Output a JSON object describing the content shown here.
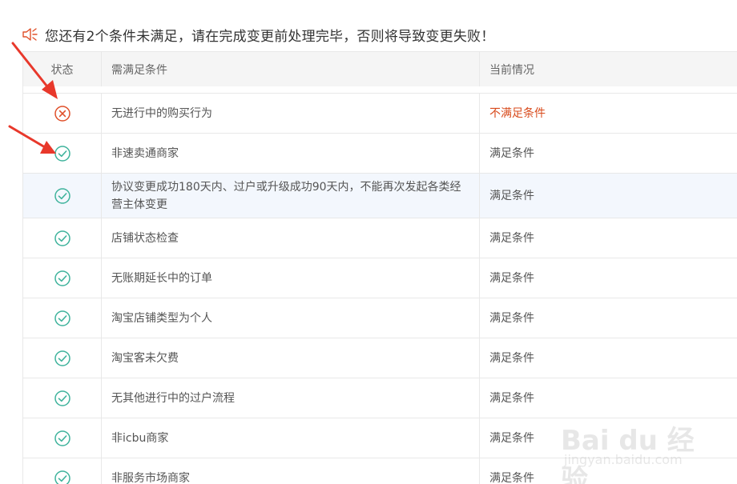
{
  "notice": {
    "icon": "speaker-icon",
    "message": "您还有2个条件未满足，请在完成变更前处理完毕，否则将导致变更失败！"
  },
  "table": {
    "headers": {
      "status": "状态",
      "condition": "需满足条件",
      "current": "当前情况"
    },
    "rows": [
      {
        "status": "fail",
        "condition": "无进行中的购买行为",
        "current": "不满足条件"
      },
      {
        "status": "ok",
        "condition": "非速卖通商家",
        "current": "满足条件"
      },
      {
        "status": "ok",
        "condition": "协议变更成功180天内、过户或升级成功90天内，不能再次发起各类经营主体变更",
        "current": "满足条件"
      },
      {
        "status": "ok",
        "condition": "店铺状态检查",
        "current": "满足条件"
      },
      {
        "status": "ok",
        "condition": "无账期延长中的订单",
        "current": "满足条件"
      },
      {
        "status": "ok",
        "condition": "淘宝店铺类型为个人",
        "current": "满足条件"
      },
      {
        "status": "ok",
        "condition": "淘宝客未欠费",
        "current": "满足条件"
      },
      {
        "status": "ok",
        "condition": "无其他进行中的过户流程",
        "current": "满足条件"
      },
      {
        "status": "ok",
        "condition": "非icbu商家",
        "current": "满足条件"
      },
      {
        "status": "ok",
        "condition": "非服务市场商家",
        "current": "满足条件"
      }
    ]
  },
  "colors": {
    "ok": "#3fb39c",
    "fail": "#e0502a",
    "arrow": "#e8382b"
  },
  "watermark": {
    "logo": "Bai du 经验",
    "url": "jingyan.baidu.com"
  }
}
